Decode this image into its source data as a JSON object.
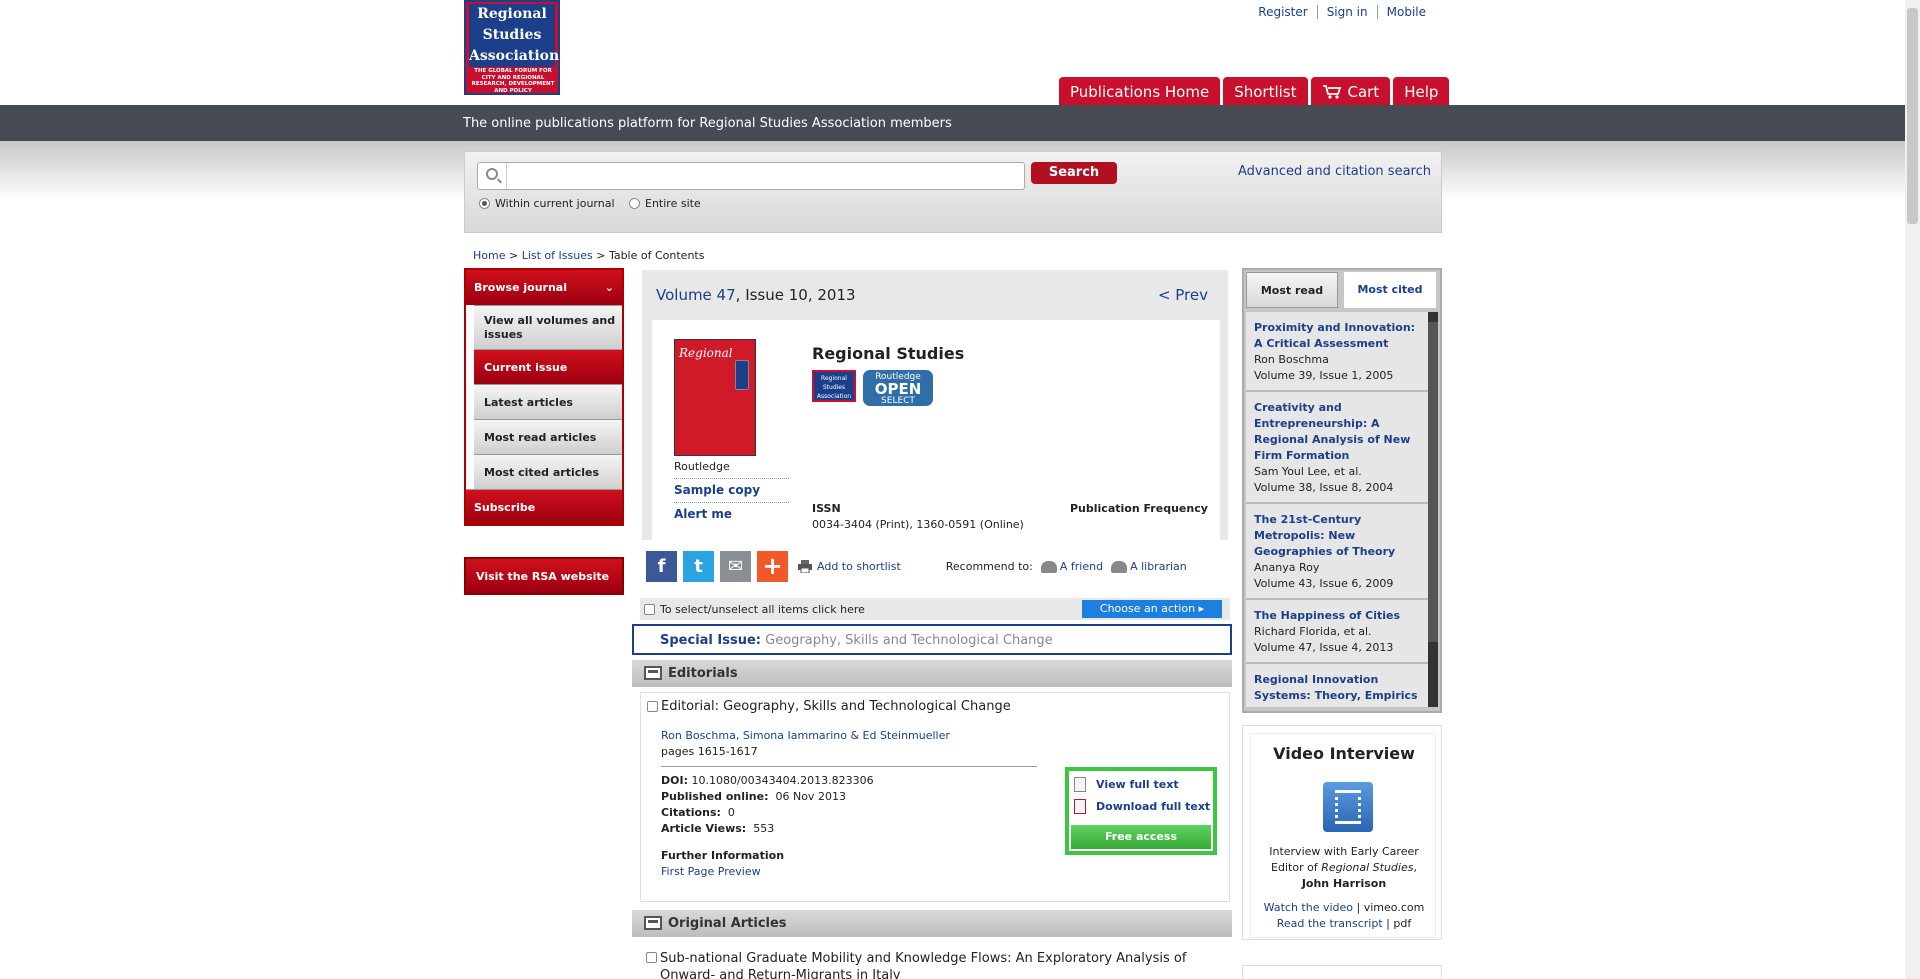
{
  "header": {
    "logo_lines": [
      "Regional",
      "Studies",
      "Association"
    ],
    "logo_tagline": "THE GLOBAL FORUM FOR CITY AND REGIONAL RESEARCH, DEVELOPMENT AND POLICY",
    "top_links": [
      "Register",
      "Sign in",
      "Mobile"
    ],
    "tabs": [
      "Publications Home",
      "Shortlist",
      "Cart",
      "Help"
    ],
    "banner": "The online publications platform for Regional Studies Association members"
  },
  "search": {
    "value": "",
    "button": "Search",
    "advanced": "Advanced and citation search",
    "scope_current": "Within current journal",
    "scope_site": "Entire site"
  },
  "breadcrumb": {
    "home": "Home",
    "list": "List of Issues",
    "current": "Table of Contents",
    "sep": ">"
  },
  "left_nav": {
    "browse": "Browse journal",
    "items": [
      "View all volumes and issues",
      "Current issue",
      "Latest articles",
      "Most read articles",
      "Most cited articles"
    ],
    "subscribe": "Subscribe",
    "rsa": "Visit the RSA website"
  },
  "issue": {
    "volume": "Volume 47",
    "rest": ", Issue 10, 2013",
    "prev": "< Prev"
  },
  "journal": {
    "cover_title": "Regional",
    "publisher": "Routledge",
    "sample": "Sample copy",
    "alert": "Alert me",
    "title": "Regional Studies",
    "rsa_badge": "Regional Studies Association",
    "open_top": "Routledge",
    "open_mid": "OPEN",
    "open_bot": "SELECT",
    "issn_label": "ISSN",
    "issn_value": "0034-3404 (Print), 1360-0591 (Online)",
    "freq_label": "Publication Frequency"
  },
  "share": {
    "add_shortlist": "Add to shortlist",
    "recommend": "Recommend to:",
    "friend": "A friend",
    "librarian": "A librarian"
  },
  "selection": {
    "text": "To select/unselect all items click here",
    "action": "Choose an action"
  },
  "special_issue": {
    "label": "Special Issue:",
    "title": "Geography, Skills and Technological Change"
  },
  "sections": {
    "editorials": "Editorials",
    "original": "Original Articles"
  },
  "article1": {
    "title": "Editorial: Geography, Skills and Technological Change",
    "authors": "Ron Boschma, Simona Iammarino & Ed Steinmueller",
    "pages": "pages 1615-1617",
    "doi_label": "DOI:",
    "doi": "10.1080/00343404.2013.823306",
    "published_label": "Published online:",
    "published": "06 Nov 2013",
    "citations_label": "Citations:",
    "citations": "0",
    "views_label": "Article Views:",
    "views": "553",
    "further": "Further Information",
    "preview": "First Page Preview",
    "view_full": "View full text",
    "download_full": "Download full text",
    "free": "Free access"
  },
  "article2": {
    "title": "Sub-national Graduate Mobility and Knowledge Flows: An Exploratory Analysis of Onward- and Return-Migrants in Italy"
  },
  "right": {
    "tab_read": "Most read",
    "tab_cited": "Most cited",
    "items": [
      {
        "title": "Proximity and Innovation: A Critical Assessment",
        "author": "Ron Boschma",
        "vol": "Volume 39, Issue 1, 2005"
      },
      {
        "title": "Creativity and Entrepreneurship: A Regional Analysis of New Firm Formation",
        "author": "Sam Youl Lee, et al.",
        "vol": "Volume 38, Issue 8, 2004"
      },
      {
        "title": "The 21st-Century Metropolis: New Geographies of Theory",
        "author": "Ananya Roy",
        "vol": "Volume 43, Issue 6, 2009"
      },
      {
        "title": "The Happiness of Cities",
        "author": "Richard Florida, et al.",
        "vol": "Volume 47, Issue 4, 2013"
      },
      {
        "title": "Regional Innovation Systems: Theory, Empirics and Policy",
        "author": "",
        "vol": ""
      }
    ]
  },
  "video": {
    "heading": "Video Interview",
    "line1": "Interview with Early Career",
    "line2a": "Editor of",
    "line2b": "Regional Studies",
    "line2c": ",",
    "name": "John Harrison",
    "watch": "Watch the video",
    "vimeo": "vimeo.com",
    "transcript": "Read the transcript",
    "pdf": "pdf",
    "sep": "|"
  },
  "colors": {
    "brand_red": "#c8102e",
    "brand_blue": "#1b3f8a",
    "banner": "#474c54",
    "access_green": "#3fc640"
  }
}
